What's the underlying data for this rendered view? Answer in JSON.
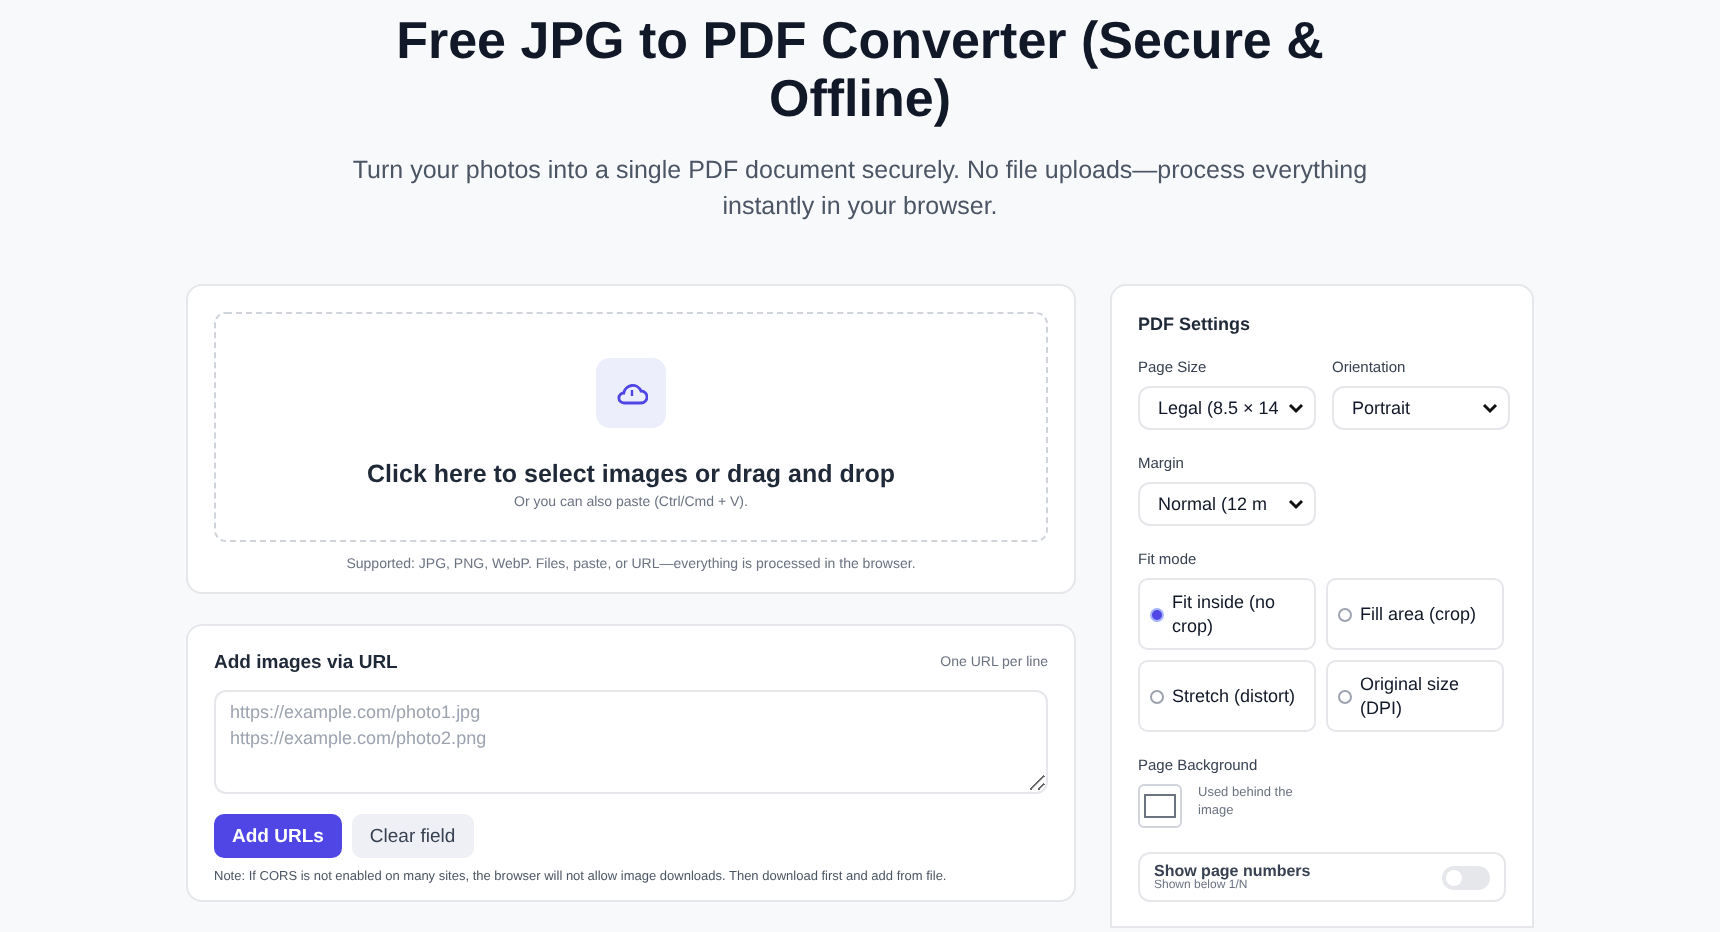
{
  "header": {
    "title": "Free JPG to PDF Converter (Secure & Offline)",
    "subtitle": "Turn your photos into a single PDF document securely. No file uploads—process everything instantly in your browser."
  },
  "upload": {
    "heading": "Click here to select images or drag and drop",
    "hint": "Or you can also paste (Ctrl/Cmd + V).",
    "supported": "Supported: JPG, PNG, WebP. Files, paste, or URL—everything is processed in the browser."
  },
  "url_card": {
    "title": "Add images via URL",
    "aside": "One URL per line",
    "placeholder": "https://example.com/photo1.jpg\nhttps://example.com/photo2.png",
    "buttons": [
      {
        "label": "Add URLs",
        "kind": "primary"
      },
      {
        "label": "Clear field",
        "kind": "secondary"
      }
    ],
    "note": "Note: If CORS is not enabled on many sites, the browser will not allow image downloads. Then download first and add from file."
  },
  "settings": {
    "title": "PDF Settings",
    "selects": [
      {
        "label": "Page Size",
        "value": "Legal (8.5 × 14"
      },
      {
        "label": "Orientation",
        "value": "Portrait"
      },
      {
        "label": "Margin",
        "value": "Normal (12 m"
      }
    ],
    "fit_label": "Fit mode",
    "fit_options": [
      {
        "label": "Fit inside (no crop)",
        "selected": true
      },
      {
        "label": "Fill area (crop)",
        "selected": false
      },
      {
        "label": "Stretch (distort)",
        "selected": false
      },
      {
        "label": "Original size (DPI)",
        "selected": false
      }
    ],
    "background": {
      "label": "Page Background",
      "color": "#ffffff",
      "hint": "Used behind the image"
    },
    "page_numbers": {
      "title": "Show page numbers",
      "hint": "Shown below 1/N",
      "on": false
    }
  }
}
